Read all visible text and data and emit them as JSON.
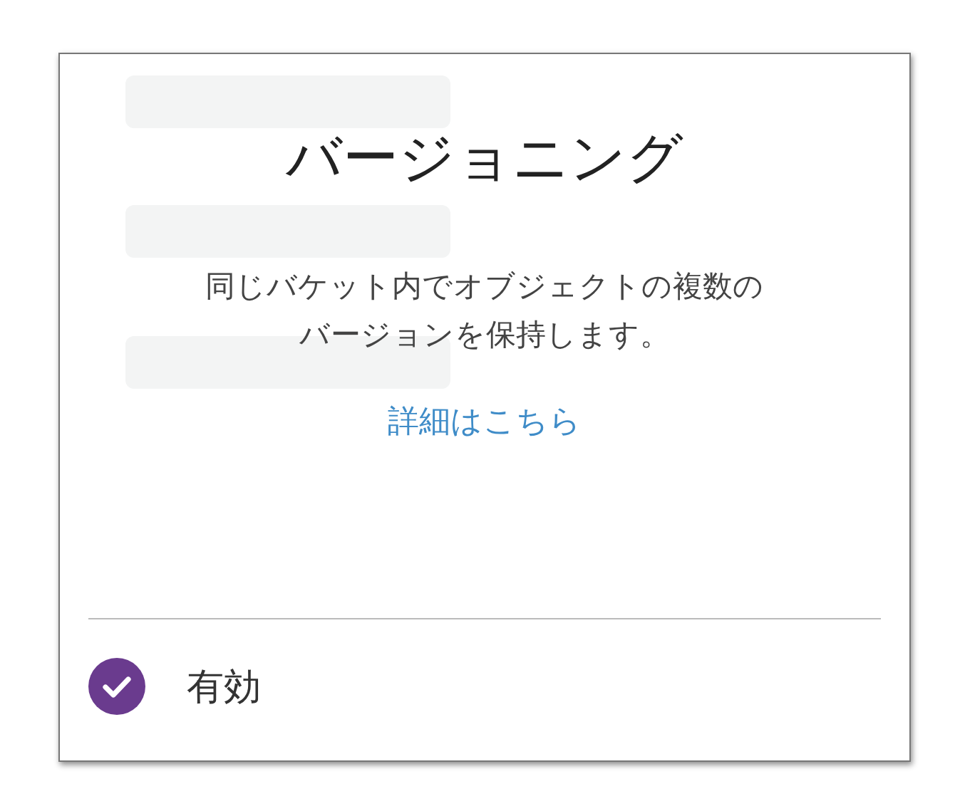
{
  "title": "バージョニング",
  "description": "同じバケット内でオブジェクトの複数のバージョンを保持します。",
  "link": "詳細はこちら",
  "option": {
    "label": "有効",
    "checked": true
  }
}
